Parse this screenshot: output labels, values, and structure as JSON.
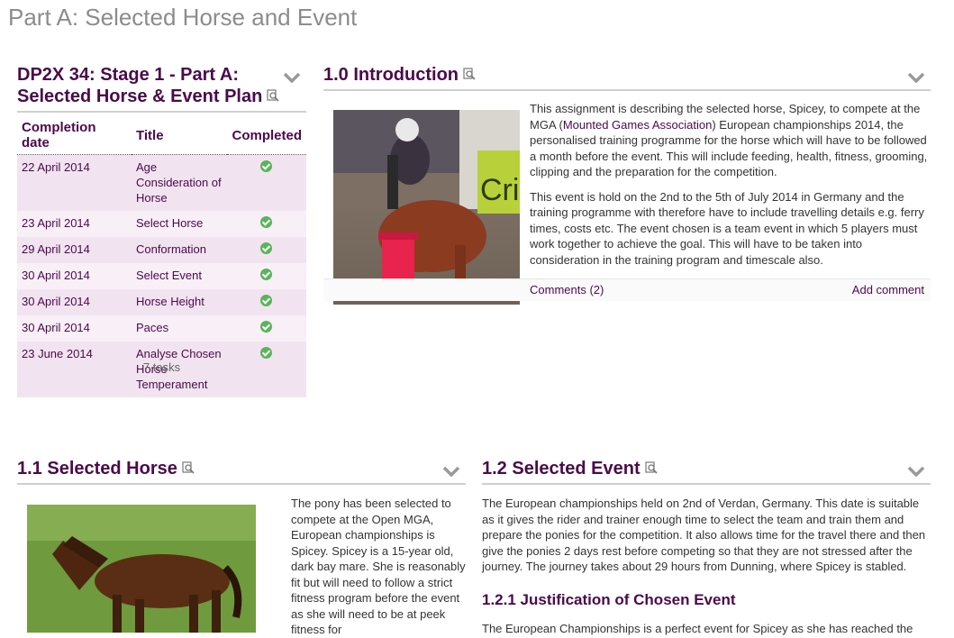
{
  "page": {
    "title": "Part A: Selected Horse and Event"
  },
  "plan": {
    "title_line1": "DP2X 34: Stage 1 - Part A:",
    "title_line2": "Selected Horse & Event Plan",
    "columns": {
      "date": "Completion date",
      "title": "Title",
      "completed": "Completed"
    },
    "rows": [
      {
        "date": "22 April 2014",
        "title": "Age Consideration of Horse",
        "completed": true
      },
      {
        "date": "23 April 2014",
        "title": "Select Horse",
        "completed": true
      },
      {
        "date": "29 April 2014",
        "title": "Conformation",
        "completed": true
      },
      {
        "date": "30 April 2014",
        "title": "Select Event",
        "completed": true
      },
      {
        "date": "30 April 2014",
        "title": "Horse Height",
        "completed": true
      },
      {
        "date": "30 April 2014",
        "title": "Paces",
        "completed": true
      },
      {
        "date": "23 June 2014",
        "title": "Analyse Chosen Horse Temperament",
        "completed": true
      }
    ],
    "count": "7 tasks"
  },
  "intro": {
    "title": "1.0 Introduction",
    "p1_a": "This assignment is describing the selected horse, Spicey, to compete at the MGA (",
    "p1_link": "Mounted Games Association",
    "p1_b": ") European championships 2014, the personalised training programme for the horse which will have to be followed a month before the event. This will include feeding, health, fitness, grooming, clipping and the preparation for the competition.",
    "p2": "This event is hold on the 2nd to the 5th of July 2014 in Germany and the training programme with therefore have to include travelling details e.g. ferry times, costs etc. The event chosen is a team event in which 5 players must work together to achieve the goal. This will have to be taken into consideration in the training program and timescale also.",
    "comments": "Comments (2)",
    "add_comment": "Add comment",
    "image_banner_text": "Cri"
  },
  "horse": {
    "title": "1.1 Selected Horse",
    "text": "The pony has been selected to compete at the Open MGA, European championships is Spicey. Spicey is a 15-year old, dark bay mare. She is reasonably fit but will need to follow a strict fitness program before the event as she will need to be at peek fitness for"
  },
  "event": {
    "title": "1.2 Selected Event",
    "text": "The European championships held on 2nd of Verdan, Germany. This date is suitable as it gives the rider and trainer enough time to select the team and train them and prepare the ponies for the competition. It also allows time for the travel there and then give the ponies 2 days rest before competing so that they are not stressed after the journey. The journey takes about 29 hours from Dunning, where Spicey is stabled.",
    "subtitle": "1.2.1 Justification of Chosen Event",
    "text2": "The European Championships is a perfect event for Spicey as she has reached the"
  },
  "colors": {
    "accent": "#4a0a4a",
    "row_odd": "#f1e4f0",
    "row_even": "#f8eff7",
    "tick": "#5bb45b"
  }
}
